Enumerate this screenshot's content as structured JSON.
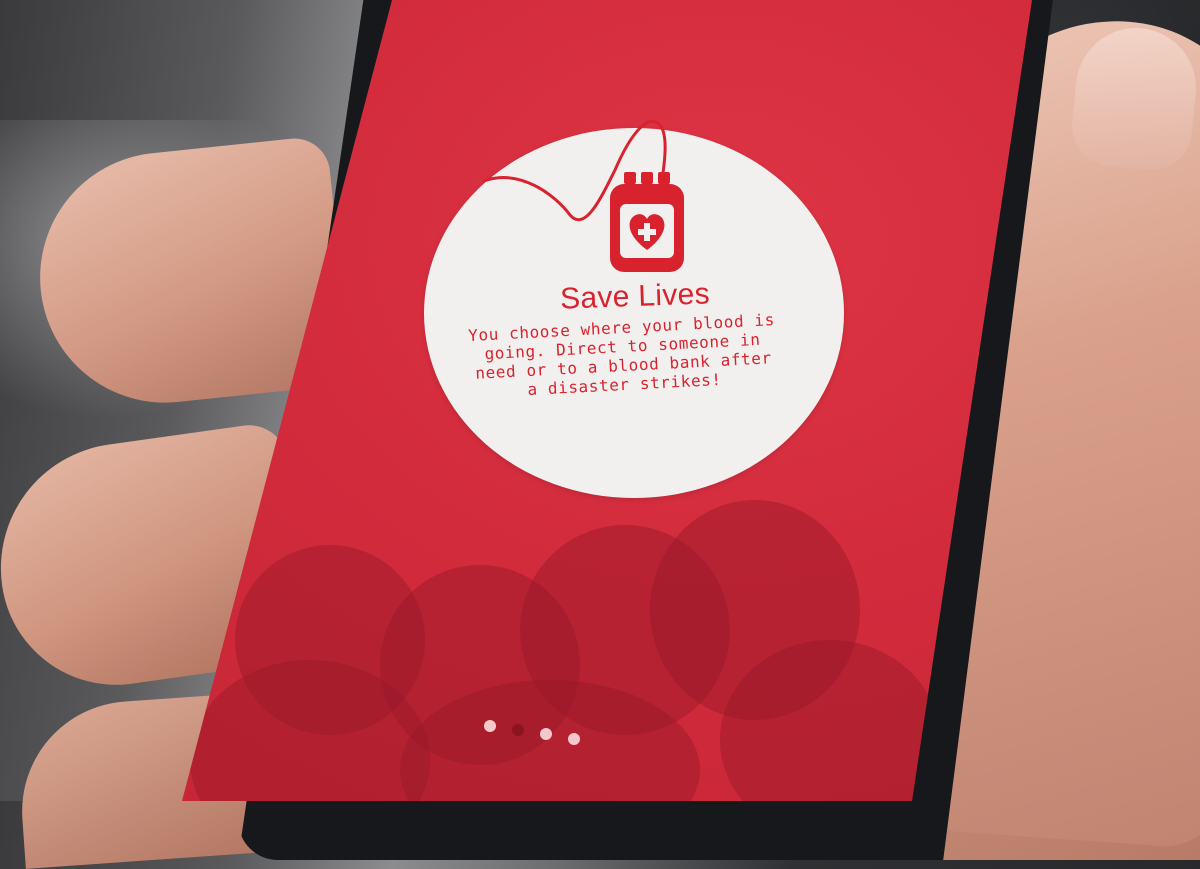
{
  "onboarding": {
    "title": "Save Lives",
    "description": "You choose where your blood is going. Direct to someone in need or to a blood bank after a disaster strikes!",
    "icon": "blood-bag-icon",
    "pagination": {
      "total": 4,
      "active_index": 1
    }
  },
  "colors": {
    "screen_red": "#d22b3c",
    "accent_red": "#d8232e",
    "card_bg": "#f1f0ef",
    "dot_active": "#8a1420",
    "dot_inactive": "#f5c9cc"
  }
}
